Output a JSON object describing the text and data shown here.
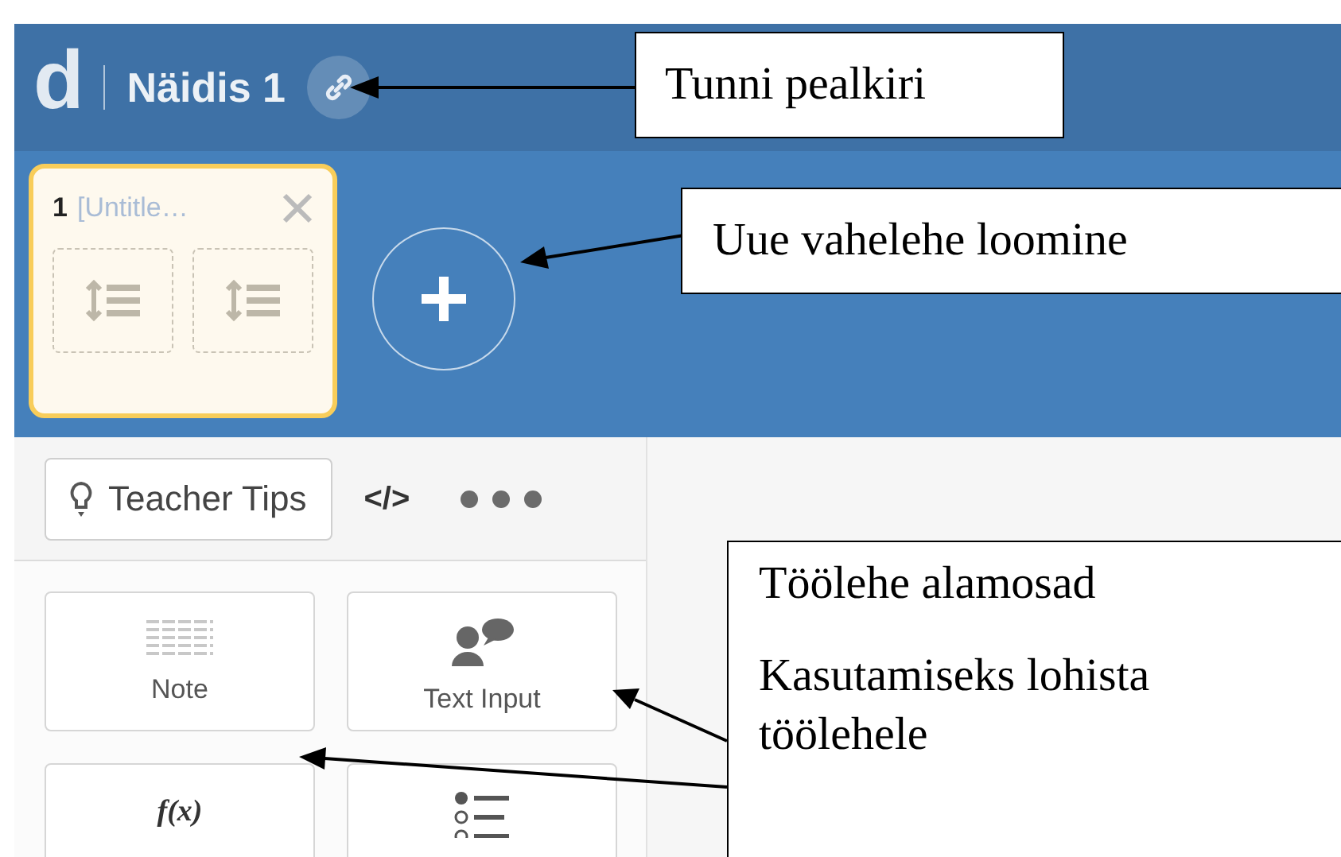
{
  "header": {
    "logo": "d",
    "title": "Näidis 1"
  },
  "screens": [
    {
      "number": "1",
      "title": "[Untitle…",
      "selected": true
    }
  ],
  "toolbar": {
    "teacher_tips": "Teacher Tips",
    "code": "</>"
  },
  "components": [
    {
      "kind": "note",
      "label": "Note"
    },
    {
      "kind": "text-input",
      "label": "Text Input"
    },
    {
      "kind": "math",
      "symbol": "f(x)"
    },
    {
      "kind": "choice"
    }
  ],
  "callouts": [
    {
      "lines": [
        "Tunni pealkiri"
      ]
    },
    {
      "lines": [
        "Uue vahelehe loomine"
      ]
    },
    {
      "lines": [
        "Töölehe alamosad",
        "Kasutamiseks lohista töölehele"
      ]
    }
  ]
}
